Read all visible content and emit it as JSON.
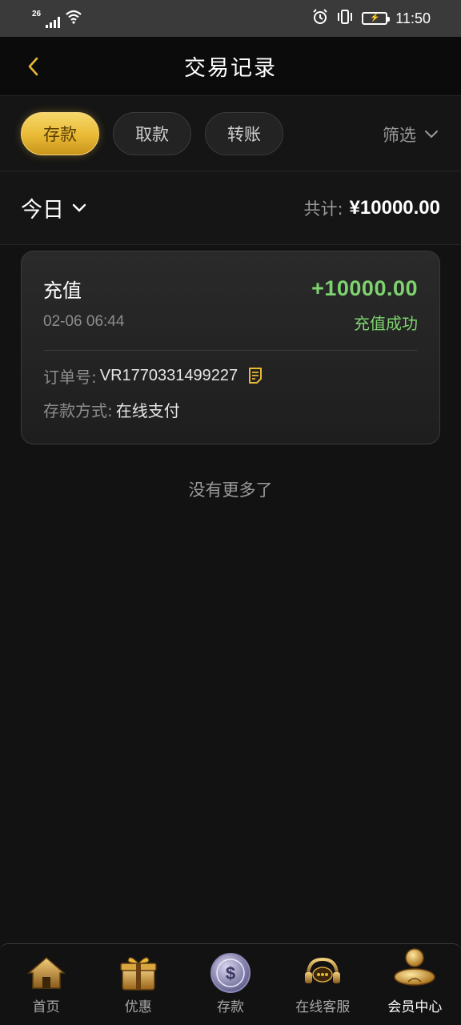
{
  "status_bar": {
    "network": "26",
    "time": "11:50",
    "icons": [
      "signal-icon",
      "wifi-icon",
      "alarm-icon",
      "vibrate-icon",
      "battery-charging-icon"
    ]
  },
  "header": {
    "title": "交易记录",
    "back_icon": "chevron-left-icon"
  },
  "tabs": {
    "items": [
      {
        "label": "存款",
        "active": true
      },
      {
        "label": "取款",
        "active": false
      },
      {
        "label": "转账",
        "active": false
      }
    ],
    "filter_label": "筛选"
  },
  "summary": {
    "date_range": "今日",
    "total_label": "共计:",
    "total_value": "¥10000.00"
  },
  "records": [
    {
      "type": "充值",
      "amount": "+10000.00",
      "time": "02-06 06:44",
      "status": "充值成功",
      "order_label": "订单号:",
      "order_no": "VR1770331499227",
      "method_label": "存款方式:",
      "method": "在线支付"
    }
  ],
  "list_end_text": "没有更多了",
  "bottom_nav": {
    "items": [
      {
        "label": "首页",
        "icon": "home-icon"
      },
      {
        "label": "优惠",
        "icon": "gift-icon"
      },
      {
        "label": "存款",
        "icon": "coin-icon"
      },
      {
        "label": "在线客服",
        "icon": "headset-icon"
      },
      {
        "label": "会员中心",
        "icon": "member-icon",
        "active": true
      }
    ]
  },
  "colors": {
    "accent_gold": "#e8b934",
    "success_green": "#7ed36f",
    "background": "#121212"
  }
}
